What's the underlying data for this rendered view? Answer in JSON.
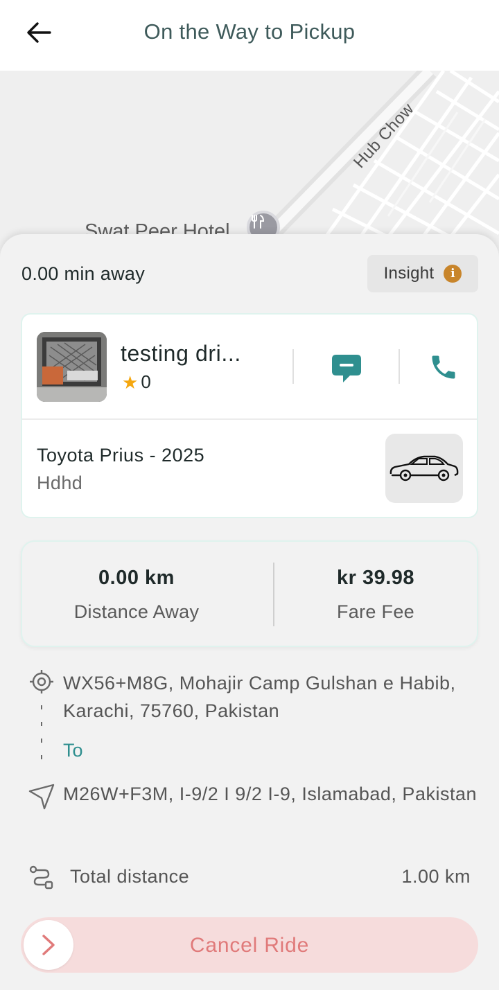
{
  "header": {
    "title": "On the Way to Pickup"
  },
  "map": {
    "road_label": "Hub Chow",
    "poi_label": "Swat Peer Hotel"
  },
  "trip": {
    "eta": "0.00 min away",
    "insight_label": "Insight"
  },
  "driver": {
    "name": "testing dri...",
    "rating": "0"
  },
  "vehicle": {
    "model": "Toyota Prius - 2025",
    "plate": "Hdhd"
  },
  "stats": {
    "distance_value": "0.00 km",
    "distance_label": "Distance Away",
    "fare_value": "kr 39.98",
    "fare_label": "Fare Fee"
  },
  "route": {
    "pickup": "WX56+M8G, Mohajir Camp Gulshan e Habib, Karachi, 75760, Pakistan",
    "to_label": "To",
    "dropoff": "M26W+F3M, I-9/2 I 9/2 I-9, Islamabad, Pakistan"
  },
  "total": {
    "label": "Total distance",
    "value": "1.00 km"
  },
  "actions": {
    "cancel_label": "Cancel Ride"
  },
  "colors": {
    "accent": "#2f8f8f",
    "star": "#f5a70f",
    "info": "#c8852b",
    "cancel_bg": "#f6dcdc",
    "cancel_text": "#e07a7a"
  },
  "icons": {
    "back": "arrow-left-icon",
    "info": "info-icon",
    "chat": "chat-icon",
    "call": "phone-icon",
    "car": "car-icon",
    "pickup": "location-target-icon",
    "dropoff": "navigation-pin-icon",
    "route": "route-icon",
    "slider": "chevron-right-icon",
    "poi": "restaurant-icon"
  }
}
